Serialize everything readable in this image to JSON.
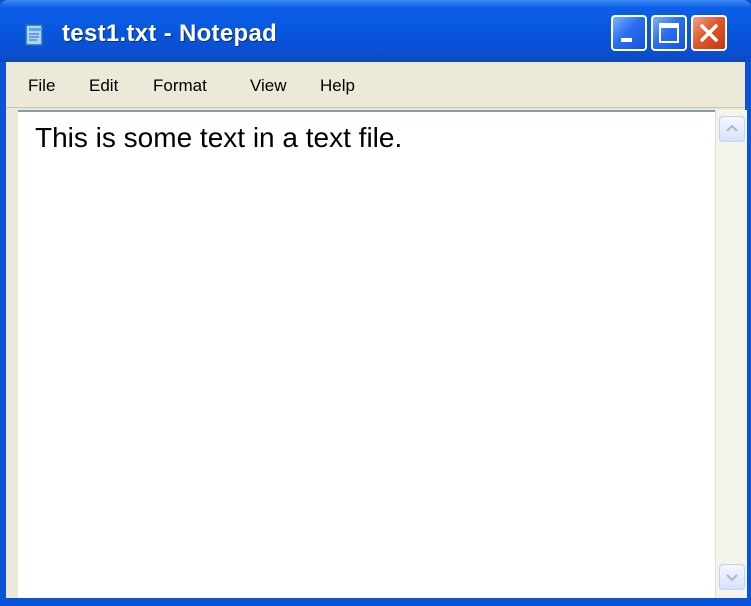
{
  "window": {
    "title": "test1.txt - Notepad",
    "icon": "notepad-icon",
    "controls": {
      "minimize": "minimize-icon",
      "maximize": "maximize-icon",
      "close": "close-icon"
    }
  },
  "menu": {
    "items": [
      "File",
      "Edit",
      "Format",
      "View",
      "Help"
    ]
  },
  "editor": {
    "content": "This is some text in a text file."
  },
  "scrollbar": {
    "up": "arrow-up-icon",
    "down": "arrow-down-icon"
  },
  "colors": {
    "titlebar": "#0a53d6",
    "close_button": "#e0582d",
    "menubar": "#ece9d8",
    "editor_bg": "#ffffff"
  }
}
